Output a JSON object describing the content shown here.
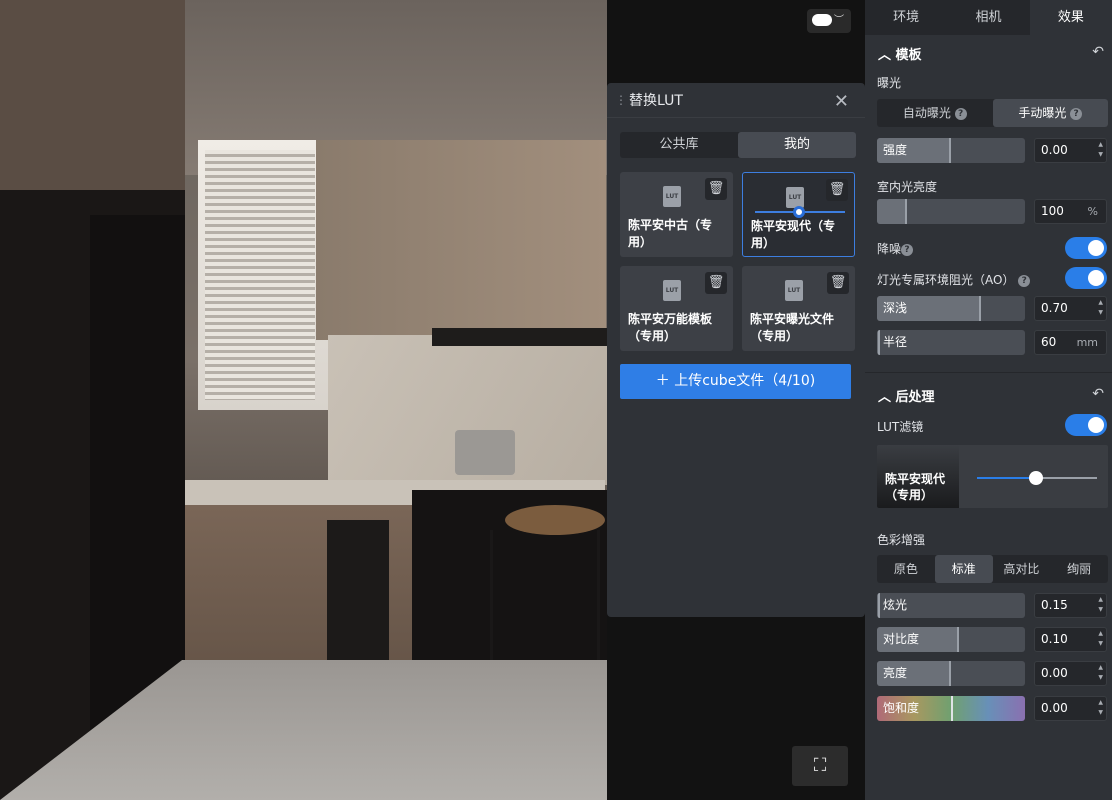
{
  "lut_dialog": {
    "title": "替换LUT",
    "tabs": [
      {
        "label": "公共库"
      },
      {
        "label": "我的"
      }
    ],
    "cards": [
      {
        "name": "陈平安中古（专用）"
      },
      {
        "name": "陈平安现代（专用）"
      },
      {
        "name": "陈平安万能模板（专用）"
      },
      {
        "name": "陈平安曝光文件（专用）"
      }
    ],
    "upload_label": "＋ 上传cube文件（4/10)",
    "card_icon_text": "LUT"
  },
  "panel": {
    "tabs": [
      {
        "label": "环境"
      },
      {
        "label": "相机"
      },
      {
        "label": "效果"
      }
    ],
    "template": {
      "title": "模板",
      "exposure_label": "曝光",
      "exposure_modes": [
        {
          "label": "自动曝光"
        },
        {
          "label": "手动曝光"
        }
      ],
      "intensity": {
        "label": "强度",
        "value": "0.00"
      },
      "indoor": {
        "label": "室内光亮度",
        "value": "100",
        "unit": "%"
      },
      "denoise": {
        "label": "降噪"
      },
      "ao": {
        "label": "灯光专属环境阻光（AO）"
      },
      "depth": {
        "label": "深浅",
        "value": "0.70"
      },
      "radius": {
        "label": "半径",
        "value": "60",
        "unit": "mm"
      }
    },
    "post": {
      "title": "后处理",
      "lut_label": "LUT滤镜",
      "lut_name": "陈平安现代（专用）",
      "lut_strength": 0.48,
      "color_label": "色彩增强",
      "color_modes": [
        {
          "label": "原色"
        },
        {
          "label": "标准"
        },
        {
          "label": "高对比"
        },
        {
          "label": "绚丽"
        }
      ],
      "glare": {
        "label": "炫光",
        "value": "0.15"
      },
      "contrast": {
        "label": "对比度",
        "value": "0.10"
      },
      "brightness": {
        "label": "亮度",
        "value": "0.00"
      },
      "saturation": {
        "label": "饱和度",
        "value": "0.00"
      }
    }
  }
}
